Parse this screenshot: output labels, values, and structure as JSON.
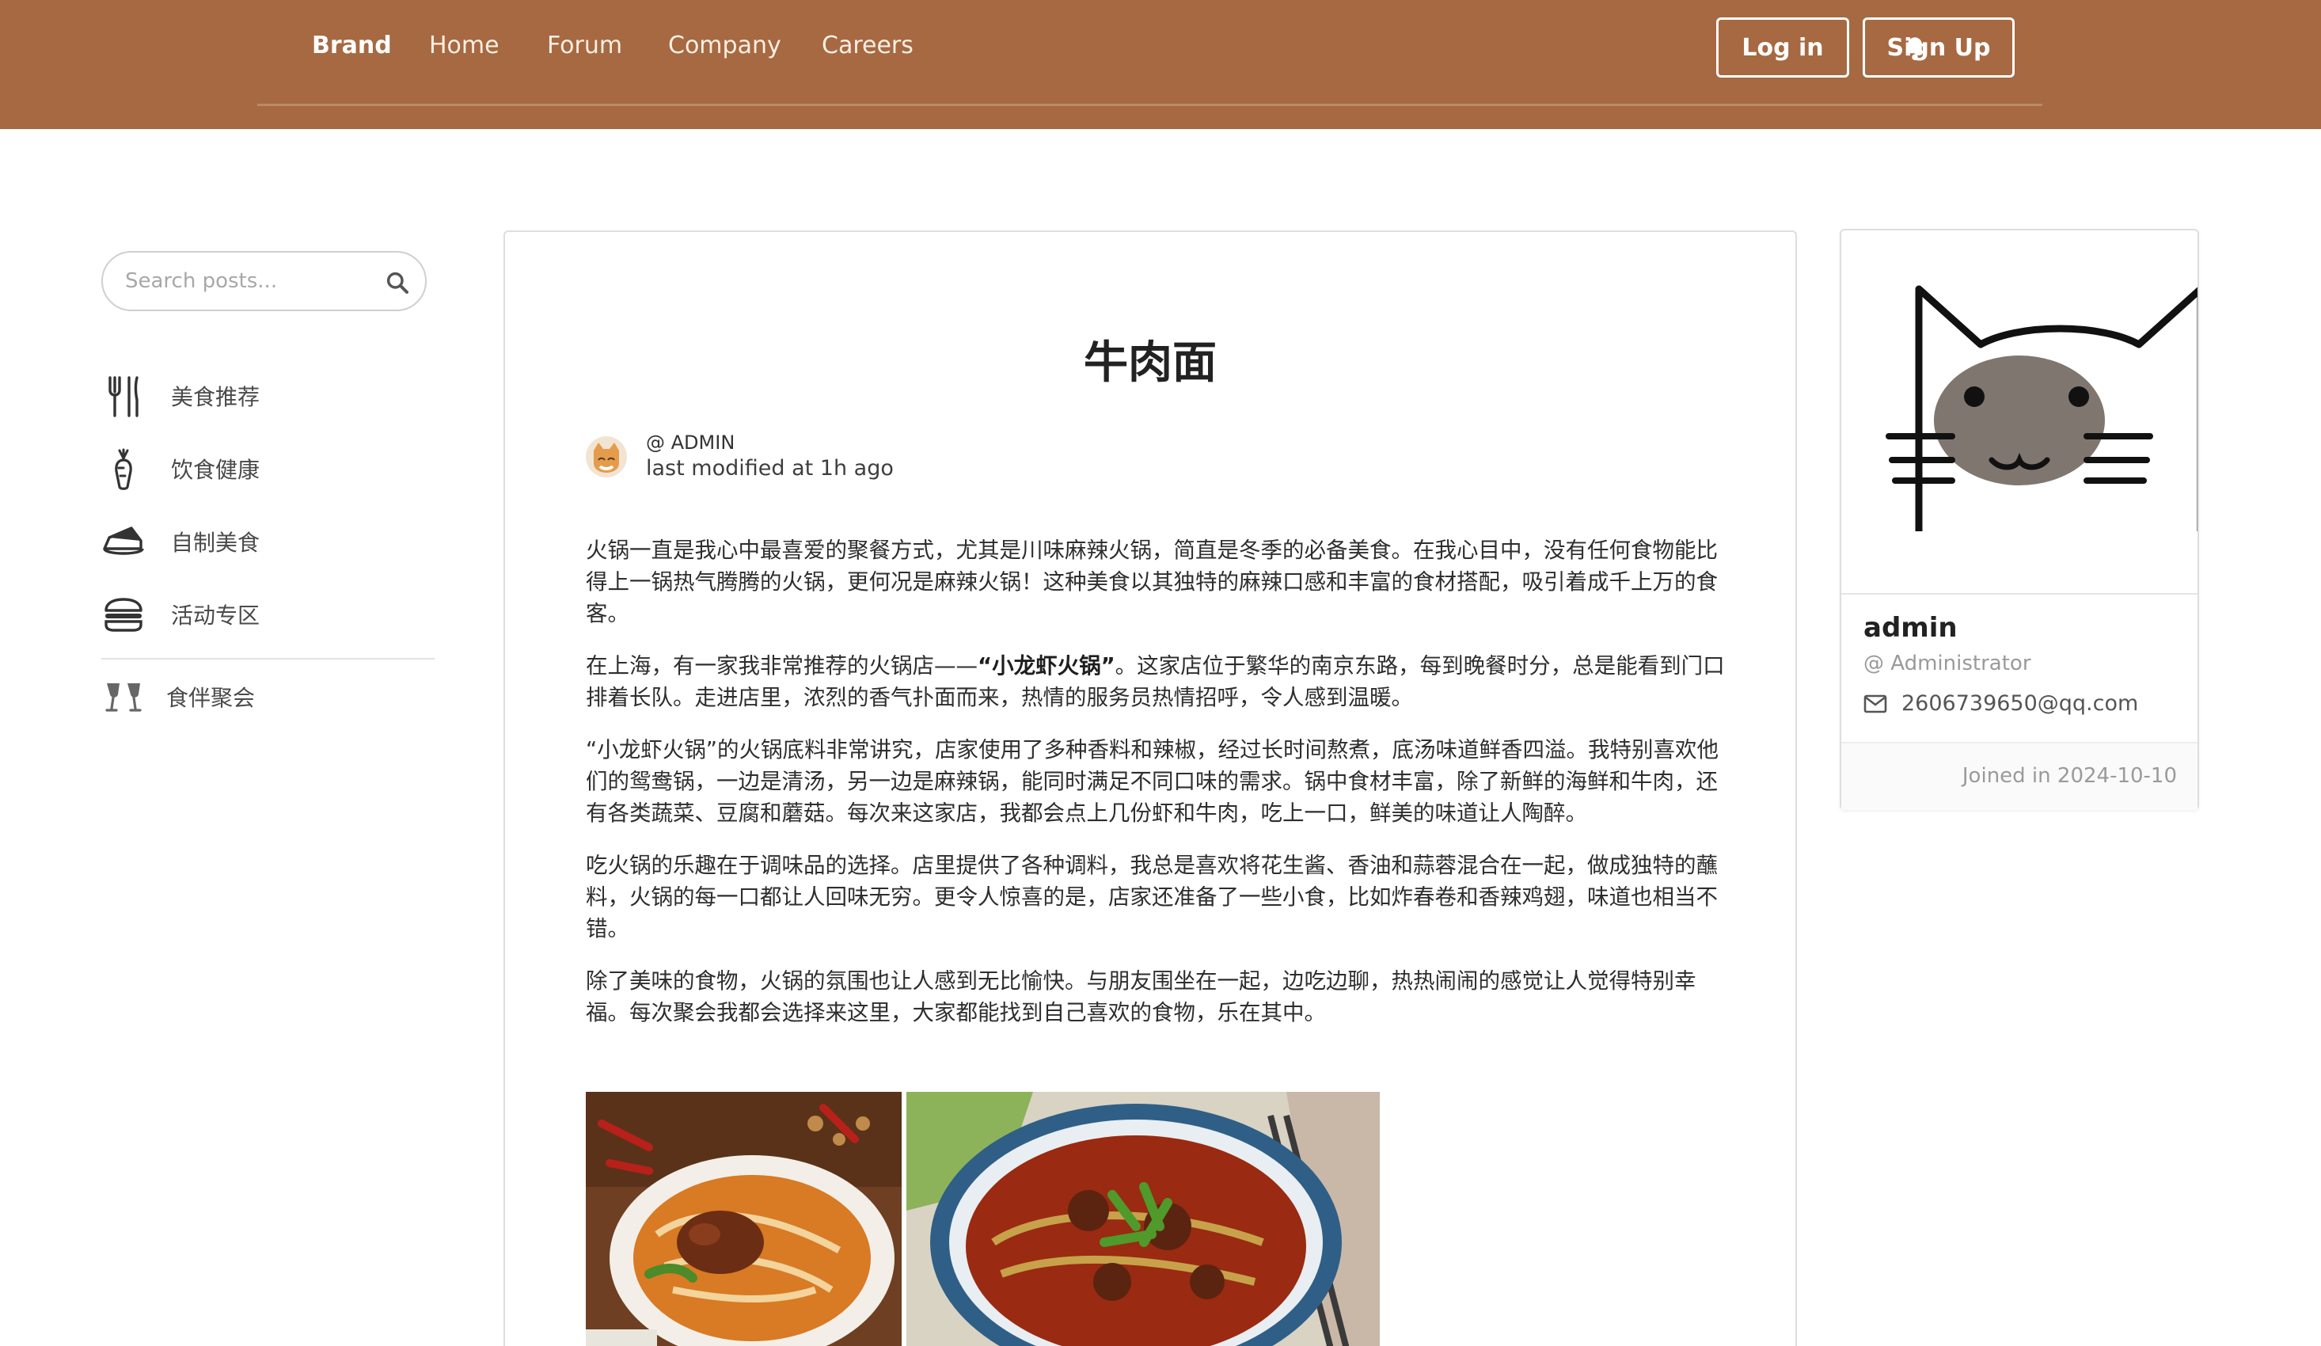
{
  "navbar": {
    "brand": "Brand",
    "links": [
      "Home",
      "Forum",
      "Company",
      "Careers"
    ],
    "notification_icon": "bell-icon",
    "login_label": "Log in",
    "signup_label": "Sign Up",
    "background_color": "#a66941"
  },
  "sidebar": {
    "search_placeholder": "Search posts...",
    "search_icon": "search-icon",
    "items": [
      {
        "label": "美食推荐",
        "icon": "utensils-icon"
      },
      {
        "label": "饮食健康",
        "icon": "carrot-icon"
      },
      {
        "label": "自制美食",
        "icon": "cake-icon"
      },
      {
        "label": "活动专区",
        "icon": "burger-icon"
      },
      {
        "label": "食伴聚会",
        "icon": "cheers-icon"
      }
    ]
  },
  "post": {
    "title": "牛肉面",
    "author": "@ ADMIN",
    "meta": "last modified at 1h ago",
    "p1": "火锅一直是我心中最喜爱的聚餐方式，尤其是川味麻辣火锅，简直是冬季的必备美食。在我心目中，没有任何食物能比得上一锅热气腾腾的火锅，更何况是麻辣火锅！这种美食以其独特的麻辣口感和丰富的食材搭配，吸引着成千上万的食客。",
    "p2_before": "在上海，有一家我非常推荐的火锅店——",
    "p2_bold": "“小龙虾火锅”",
    "p2_after": "。这家店位于繁华的南京东路，每到晚餐时分，总是能看到门口排着长队。走进店里，浓烈的香气扑面而来，热情的服务员热情招呼，令人感到温暖。",
    "p3": "“小龙虾火锅”的火锅底料非常讲究，店家使用了多种香料和辣椒，经过长时间熬煮，底汤味道鲜香四溢。我特别喜欢他们的鸳鸯锅，一边是清汤，另一边是麻辣锅，能同时满足不同口味的需求。锅中食材丰富，除了新鲜的海鲜和牛肉，还有各类蔬菜、豆腐和蘑菇。每次来这家店，我都会点上几份虾和牛肉，吃上一口，鲜美的味道让人陶醉。",
    "p4": "吃火锅的乐趣在于调味品的选择。店里提供了各种调料，我总是喜欢将花生酱、香油和蒜蓉混合在一起，做成独特的蘸料，火锅的每一口都让人回味无穷。更令人惊喜的是，店家还准备了一些小食，比如炸春卷和香辣鸡翅，味道也相当不错。",
    "p5": "除了美味的食物，火锅的氛围也让人感到无比愉快。与朋友围坐在一起，边吃边聊，热热闹闹的感觉让人觉得特别幸福。每次聚会我都会选择来这里，大家都能找到自己喜欢的食物，乐在其中。"
  },
  "profile": {
    "name": "admin",
    "role": "@ Administrator",
    "email": "2606739650@qq.com",
    "joined": "Joined in 2024-10-10"
  }
}
